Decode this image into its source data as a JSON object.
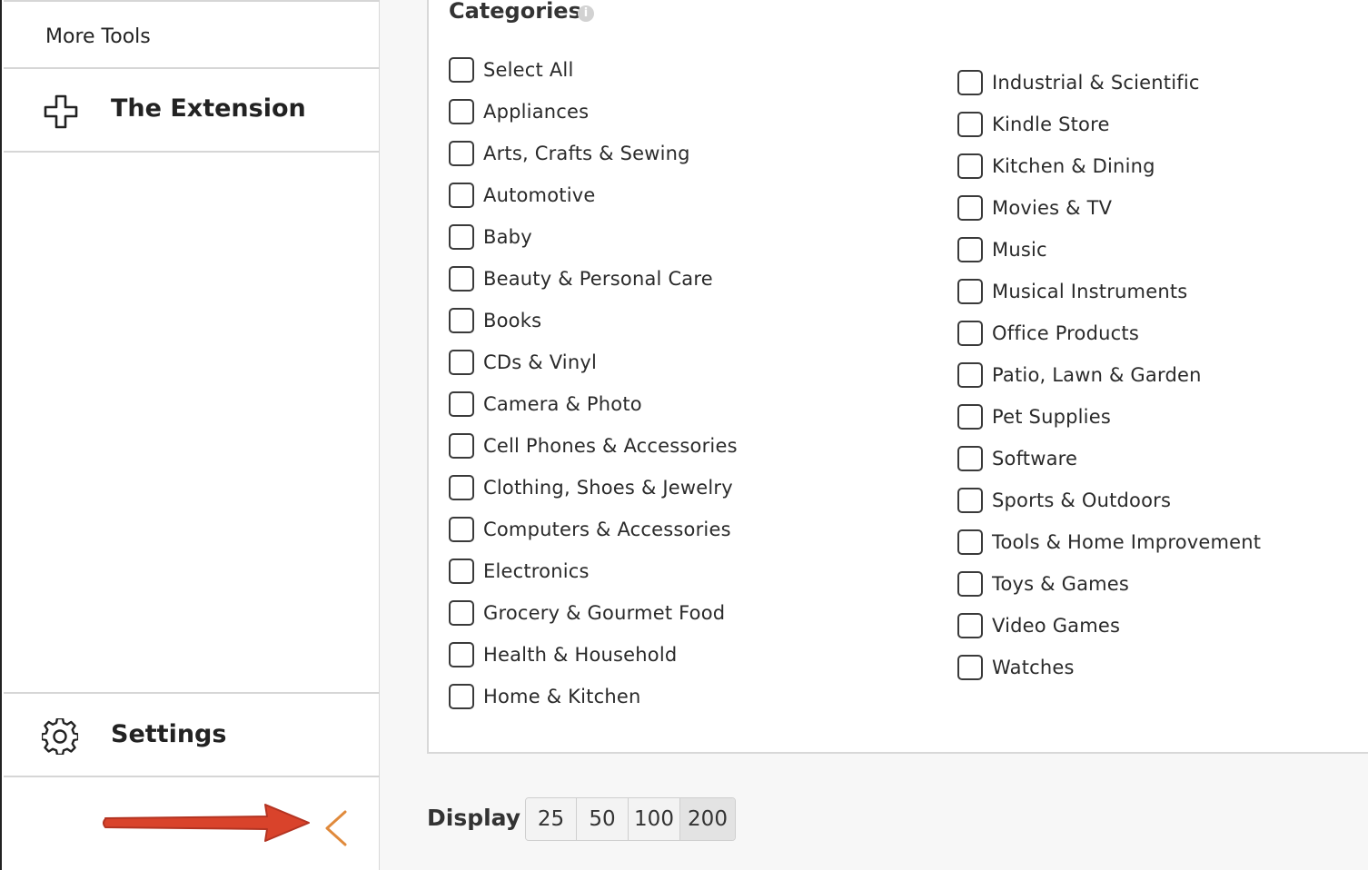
{
  "sidebar": {
    "more_tools": "More Tools",
    "extension_label": "The Extension",
    "extension_icon": "plus-outline-icon",
    "settings_label": "Settings",
    "settings_icon": "gear-icon",
    "collapse_icon": "chevron-left-icon",
    "annotation_color": "#d9432b",
    "collapse_color": "#e08a3c"
  },
  "categories": {
    "title": "Categories",
    "info_glyph": "i",
    "left_column": [
      "Select All",
      "Appliances",
      "Arts, Crafts & Sewing",
      "Automotive",
      "Baby",
      "Beauty & Personal Care",
      "Books",
      "CDs & Vinyl",
      "Camera & Photo",
      "Cell Phones & Accessories",
      "Clothing, Shoes & Jewelry",
      "Computers & Accessories",
      "Electronics",
      "Grocery & Gourmet Food",
      "Health & Household",
      "Home & Kitchen"
    ],
    "right_column": [
      "Industrial & Scientific",
      "Kindle Store",
      "Kitchen & Dining",
      "Movies & TV",
      "Music",
      "Musical Instruments",
      "Office Products",
      "Patio, Lawn & Garden",
      "Pet Supplies",
      "Software",
      "Sports & Outdoors",
      "Tools & Home Improvement",
      "Toys & Games",
      "Video Games",
      "Watches"
    ]
  },
  "display": {
    "label": "Display",
    "options": [
      "25",
      "50",
      "100",
      "200"
    ],
    "selected": "200"
  }
}
